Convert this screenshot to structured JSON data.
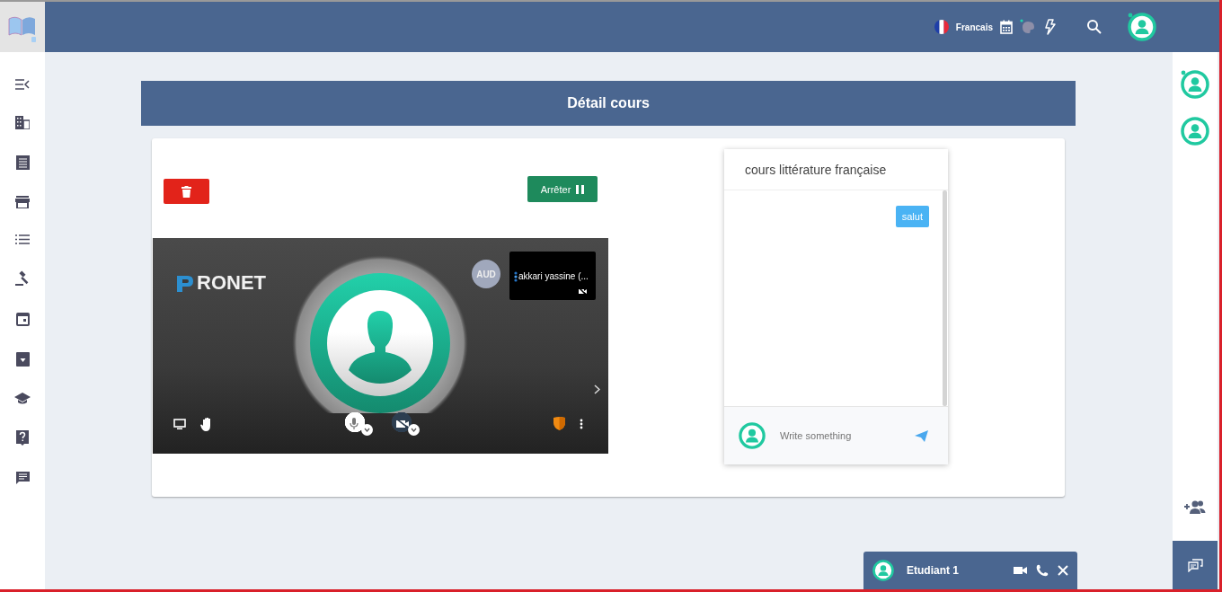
{
  "topbar": {
    "language": "Francais",
    "user_online": true
  },
  "page": {
    "title": "Détail cours"
  },
  "actions": {
    "stop_label": "Arrêter"
  },
  "video": {
    "logo": "RONET",
    "audio_badge": "AUD",
    "participant": "akkari yassine (...",
    "mic_on": true,
    "camera_on": false
  },
  "chat": {
    "title": "cours littérature française",
    "messages": [
      "salut"
    ],
    "placeholder": "Write something"
  },
  "contacts": [
    {
      "online": true
    },
    {
      "online": false
    }
  ],
  "chat_window": {
    "name": "Etudiant 1"
  }
}
